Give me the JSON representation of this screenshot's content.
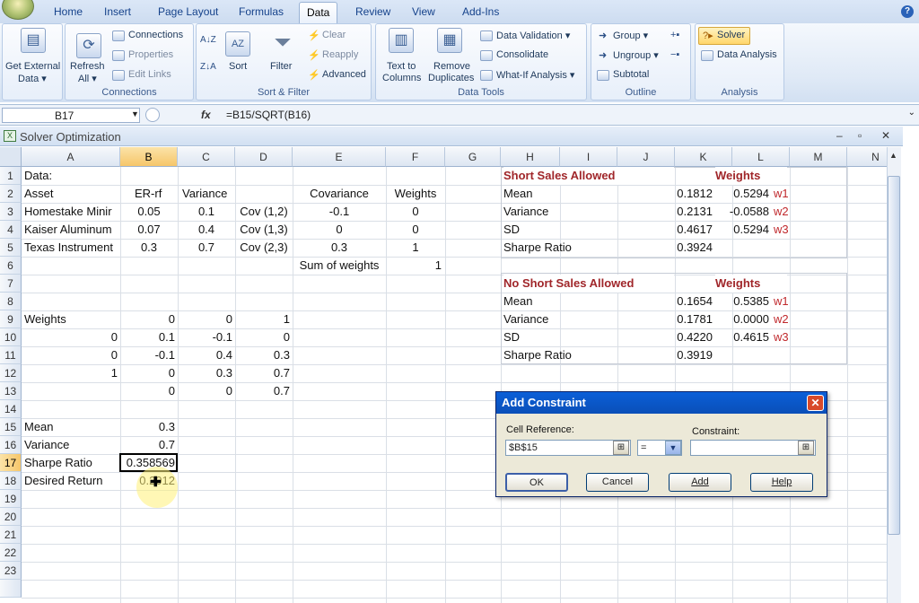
{
  "ribbon": {
    "tabs": [
      "Home",
      "Insert",
      "Page Layout",
      "Formulas",
      "Data",
      "Review",
      "View",
      "Add-Ins"
    ],
    "active_tab": "Data",
    "help_symbol": "?",
    "get_external": {
      "line1": "Get External",
      "line2": "Data ▾"
    },
    "connections": {
      "refresh_line1": "Refresh",
      "refresh_line2": "All ▾",
      "connections": "Connections",
      "properties": "Properties",
      "edit_links": "Edit Links",
      "label": "Connections"
    },
    "sort_filter": {
      "sort_az": "A↓Z",
      "sort_za": "Z↓A",
      "sort": "Sort",
      "filter": "Filter",
      "clear": "Clear",
      "reapply": "Reapply",
      "advanced": "Advanced",
      "label": "Sort & Filter"
    },
    "data_tools": {
      "text_to_columns_1": "Text to",
      "text_to_columns_2": "Columns",
      "remove_dup_1": "Remove",
      "remove_dup_2": "Duplicates",
      "data_validation": "Data Validation ▾",
      "consolidate": "Consolidate",
      "what_if": "What-If Analysis ▾",
      "label": "Data Tools"
    },
    "outline": {
      "group": "Group ▾",
      "ungroup": "Ungroup ▾",
      "subtotal": "Subtotal",
      "label": "Outline"
    },
    "analysis": {
      "solver": "Solver",
      "data_analysis": "Data Analysis",
      "label": "Analysis"
    }
  },
  "formula_bar": {
    "name_box": "B17",
    "fx": "fx",
    "formula": "=B15/SQRT(B16)"
  },
  "workbook": {
    "title": "Solver Optimization",
    "controls": [
      "‒",
      "▫",
      "✕"
    ]
  },
  "grid": {
    "columns": [
      "A",
      "B",
      "C",
      "D",
      "E",
      "F",
      "G",
      "H",
      "I",
      "J",
      "K",
      "L",
      "M",
      "N"
    ],
    "rows": [
      "1",
      "2",
      "3",
      "4",
      "5",
      "6",
      "7",
      "8",
      "9",
      "10",
      "11",
      "12",
      "13",
      "14",
      "15",
      "16",
      "17",
      "18",
      "19",
      "20",
      "21",
      "22",
      "23"
    ],
    "cells": {
      "A1": "Data:",
      "A2": "Asset",
      "B2": "ER-rf",
      "C2": "Variance",
      "E2": "Covariance",
      "F2": "Weights",
      "A3": "Homestake Minir",
      "B3": "0.05",
      "C3": "0.1",
      "D3": "Cov (1,2)",
      "E3": "-0.1",
      "F3": "0",
      "A4": "Kaiser Aluminum",
      "B4": "0.07",
      "C4": "0.4",
      "D4": "Cov (1,3)",
      "E4": "0",
      "F4": "0",
      "A5": "Texas Instrument",
      "B5": "0.3",
      "C5": "0.7",
      "D5": "Cov (2,3)",
      "E5": "0.3",
      "F5": "1",
      "E6": "Sum of weights",
      "F6": "1",
      "A9": "Weights",
      "B9": "0",
      "C9": "0",
      "D9": "1",
      "A10": "0",
      "B10": "0.1",
      "C10": "-0.1",
      "D10": "0",
      "A11": "0",
      "B11": "-0.1",
      "C11": "0.4",
      "D11": "0.3",
      "A12": "1",
      "B12": "0",
      "C12": "0.3",
      "D12": "0.7",
      "B13": "0",
      "C13": "0",
      "D13": "0.7",
      "A15": "Mean",
      "B15": "0.3",
      "A16": "Variance",
      "B16": "0.7",
      "A17": "Sharpe Ratio",
      "B17": "0.358569",
      "A18": "Desired Return",
      "B18": "0.2012"
    },
    "short_sales": {
      "title": "Short Sales Allowed",
      "weights_header": "Weights",
      "rows": [
        {
          "label": "Mean",
          "value": "0.1812",
          "weight": "0.5294",
          "tag": "w1"
        },
        {
          "label": "Variance",
          "value": "0.2131",
          "weight": "-0.0588",
          "tag": "w2"
        },
        {
          "label": "SD",
          "value": "0.4617",
          "weight": "0.5294",
          "tag": "w3"
        },
        {
          "label": "Sharpe Ratio",
          "value": "0.3924",
          "weight": "",
          "tag": ""
        }
      ]
    },
    "no_short_sales": {
      "title": "No Short Sales Allowed",
      "weights_header": "Weights",
      "rows": [
        {
          "label": "Mean",
          "value": "0.1654",
          "weight": "0.5385",
          "tag": "w1"
        },
        {
          "label": "Variance",
          "value": "0.1781",
          "weight": "0.0000",
          "tag": "w2"
        },
        {
          "label": "SD",
          "value": "0.4220",
          "weight": "0.4615",
          "tag": "w3"
        },
        {
          "label": "Sharpe Ratio",
          "value": "0.3919",
          "weight": "",
          "tag": ""
        }
      ]
    }
  },
  "dialog": {
    "title": "Add Constraint",
    "cell_ref_label": "Cell Reference:",
    "cell_ref_value": "$B$15",
    "operator": "=",
    "constraint_label": "Constraint:",
    "constraint_value": "",
    "ok": "OK",
    "cancel": "Cancel",
    "add": "Add",
    "help": "Help"
  },
  "icons": [
    "office-button-icon",
    "refresh-icon",
    "sort-az-icon",
    "sort-za-icon",
    "filter-icon",
    "solver-icon",
    "data-analysis-icon",
    "text-to-columns-icon",
    "remove-duplicates-icon",
    "cell-reference-picker-icon",
    "close-icon"
  ]
}
